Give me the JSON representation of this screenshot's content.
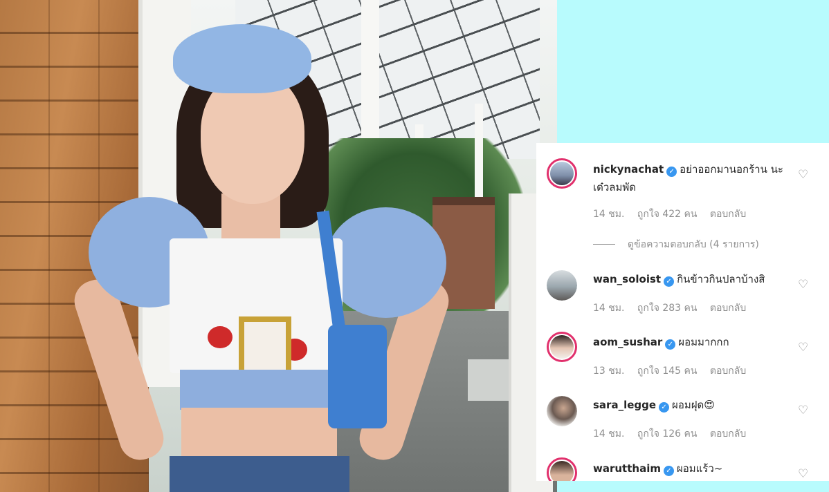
{
  "comments": [
    {
      "username": "nickynachat",
      "verified_icon": "verified-badge-icon",
      "text": "อย่าออกมานอกร้าน นะ เด๋วลมพัด",
      "time": "14 ชม.",
      "likes": "ถูกใจ 422 คน",
      "reply": "ตอบกลับ",
      "view_replies": "ดูข้อความตอบกลับ (4 รายการ)"
    },
    {
      "username": "wan_soloist",
      "verified_icon": "verified-badge-icon",
      "text": "กินข้าวกินปลาบ้างสิ",
      "time": "14 ชม.",
      "likes": "ถูกใจ 283 คน",
      "reply": "ตอบกลับ"
    },
    {
      "username": "aom_sushar",
      "verified_icon": "verified-badge-icon",
      "text": "ผอมมากกก",
      "time": "13 ชม.",
      "likes": "ถูกใจ 145 คน",
      "reply": "ตอบกลับ"
    },
    {
      "username": "sara_legge",
      "verified_icon": "verified-badge-icon",
      "text": "ผอมฝุด",
      "emoji": "😍",
      "time": "14 ชม.",
      "likes": "ถูกใจ 126 คน",
      "reply": "ตอบกลับ"
    },
    {
      "username": "warutthaim",
      "verified_icon": "verified-badge-icon",
      "text": "ผอมแร้ว~"
    }
  ],
  "colors": {
    "background": "#b8fbfd",
    "story_ring": "#e1306c",
    "verified": "#3897f0",
    "meta_text": "#8e8e8e"
  },
  "icons": {
    "heart": "heart-outline-icon",
    "verified": "verified-badge-icon"
  }
}
